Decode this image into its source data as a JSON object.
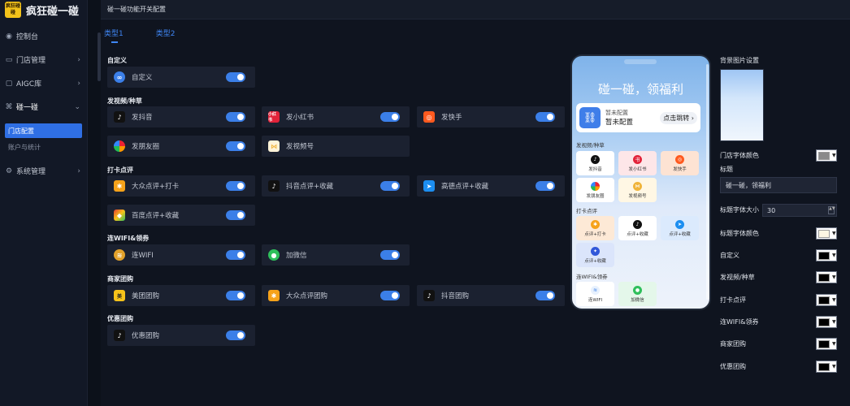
{
  "brand": {
    "logo_text": "疯狂碰碰",
    "name": "疯狂碰一碰"
  },
  "sidebar": {
    "items": [
      {
        "label": "控制台",
        "icon": "dashboard-icon",
        "arrow": ""
      },
      {
        "label": "门店管理",
        "icon": "store-icon",
        "arrow": "›"
      },
      {
        "label": "AIGC库",
        "icon": "aigc-icon",
        "arrow": "›"
      },
      {
        "label": "碰一碰",
        "icon": "tap-icon",
        "arrow": "⌄"
      }
    ],
    "sub_items": [
      {
        "label": "门店配置",
        "active": true
      },
      {
        "label": "账户与统计",
        "active": false
      }
    ],
    "system": {
      "label": "系统管理",
      "icon": "gear-icon",
      "arrow": "›"
    }
  },
  "topbar": {
    "title": "碰一碰功能开关配置"
  },
  "tabs": [
    {
      "label": "类型1",
      "active": true
    },
    {
      "label": "类型2",
      "active": false
    }
  ],
  "sections": {
    "custom": {
      "title": "自定义",
      "items": [
        {
          "label": "自定义",
          "icon_color": "#3b7fe8"
        }
      ]
    },
    "video": {
      "title": "发视频/种草",
      "items": [
        {
          "label": "发抖音",
          "icon_color": "#111111"
        },
        {
          "label": "发小红书",
          "icon_color": "#e2233a"
        },
        {
          "label": "发快手",
          "icon_color": "#ff5a1f"
        },
        {
          "label": "发朋友圈",
          "icon_color": "#2a9d3f"
        },
        {
          "label": "发视频号",
          "icon_color": "#f0b43a"
        }
      ]
    },
    "checkin": {
      "title": "打卡点评",
      "items": [
        {
          "label": "大众点评+打卡",
          "icon_color": "#f6a21a"
        },
        {
          "label": "抖音点评+收藏",
          "icon_color": "#111111"
        },
        {
          "label": "高德点评+收藏",
          "icon_color": "#1c8ef0"
        },
        {
          "label": "百度点评+收藏",
          "icon_color": "#e3382f"
        }
      ]
    },
    "wifi": {
      "title": "连WIFI&领券",
      "items": [
        {
          "label": "连WIFI",
          "icon_color": "#e2a12a"
        },
        {
          "label": "加微信",
          "icon_color": "#2fbf5b"
        }
      ]
    },
    "merchant": {
      "title": "商家团购",
      "items": [
        {
          "label": "美团团购",
          "icon_color": "#f7c31a"
        },
        {
          "label": "大众点评团购",
          "icon_color": "#f6a21a"
        },
        {
          "label": "抖音团购",
          "icon_color": "#111111"
        }
      ]
    },
    "discount": {
      "title": "优惠团购",
      "items": [
        {
          "label": "优惠团购",
          "icon_color": "#111111"
        }
      ]
    }
  },
  "phone": {
    "title": "碰一碰，领福利",
    "card_line1": "暂未配置",
    "card_line2": "暂未配置",
    "jump_label": "点击跳转",
    "sections": [
      {
        "title": "发视频/种草",
        "tiles": [
          "发抖音",
          "发小红书",
          "发快手",
          "发朋友圈",
          "发视频号"
        ]
      },
      {
        "title": "打卡点评",
        "tiles": [
          "点评+打卡",
          "点评+收藏",
          "点评+收藏",
          "点评+收藏"
        ]
      },
      {
        "title": "连WIFI&领券",
        "tiles": [
          "连WIFI",
          "加微信"
        ]
      }
    ]
  },
  "right_panel": {
    "bg_label": "背景图片设置",
    "store_font_color_label": "门店字体颜色",
    "title_label": "标题",
    "title_value": "碰一碰，领福利",
    "title_size_label": "标题字体大小",
    "title_size_value": "30",
    "title_color_label": "标题字体颜色",
    "rows": [
      "自定义",
      "发视频/种草",
      "打卡点评",
      "连WIFI&领券",
      "商家团购",
      "优惠团购"
    ],
    "colors": {
      "store_font": "#8a8a8a",
      "title_font": "#fdf7e4",
      "row": "#000000"
    }
  }
}
